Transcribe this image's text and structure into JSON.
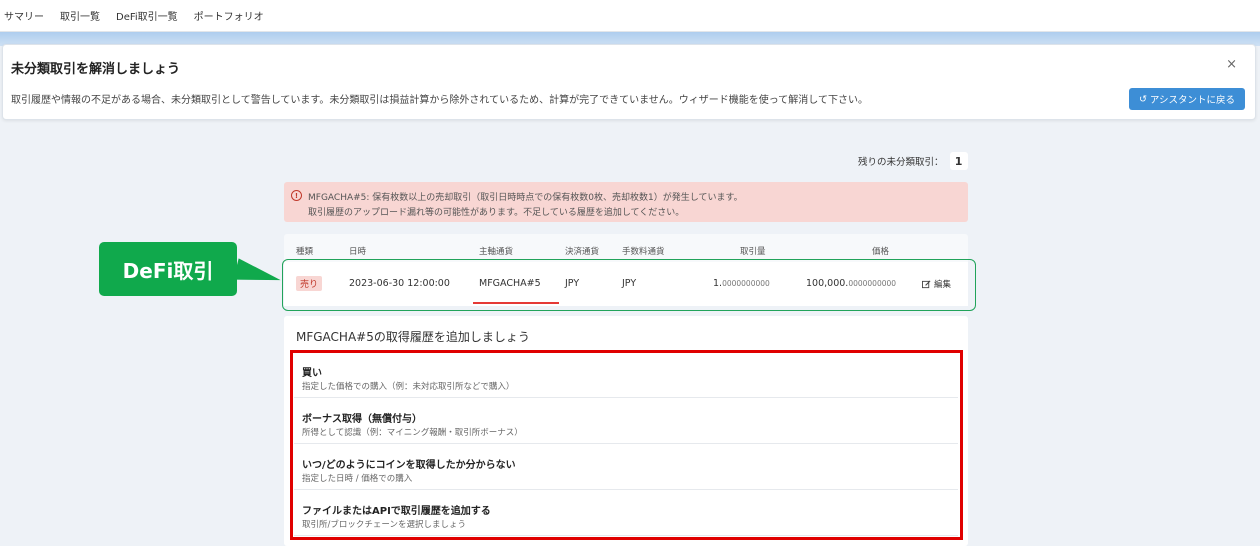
{
  "nav": {
    "items": [
      "サマリー",
      "取引一覧",
      "DeFi取引一覧",
      "ポートフォリオ"
    ]
  },
  "banner": {
    "title": "未分類取引を解消しましょう",
    "description": "取引履歴や情報の不足がある場合、未分類取引として警告しています。未分類取引は損益計算から除外されているため、計算が完了できていません。ウィザード機能を使って解消して下さい。",
    "close": "×",
    "assistant_button": "アシスタントに戻る",
    "assistant_icon": "↺"
  },
  "remaining": {
    "label": "残りの未分類取引：",
    "count": "1"
  },
  "alert": {
    "icon": "!",
    "line1": "MFGACHA#5: 保有枚数以上の売却取引（取引日時時点での保有枚数0枚、売却枚数1）が発生しています。",
    "line2": "取引履歴のアップロード漏れ等の可能性があります。不足している履歴を追加してください。"
  },
  "table": {
    "headers": [
      "種類",
      "日時",
      "主軸通貨",
      "決済通貨",
      "手数料通貨",
      "取引量",
      "価格"
    ],
    "row": {
      "type": "売り",
      "datetime": "2023-06-30 12:00:00",
      "base": "MFGACHA#5",
      "settlement": "JPY",
      "fee": "JPY",
      "amount_int": "1.",
      "amount_dec": "0000000000",
      "price_int": "100,000.",
      "price_dec": "0000000000",
      "edit": "編集"
    }
  },
  "annotation": {
    "label": "DeFi取引"
  },
  "options": {
    "title": "MFGACHA#5の取得履歴を追加しましょう",
    "items": [
      {
        "title": "買い",
        "desc": "指定した価格での購入（例：未対応取引所などで購入）"
      },
      {
        "title": "ボーナス取得（無償付与）",
        "desc": "所得として認識（例：マイニング報酬・取引所ボーナス）"
      },
      {
        "title": "いつ/どのようにコインを取得したか分からない",
        "desc": "指定した日時 / 価格での購入"
      },
      {
        "title": "ファイルまたはAPIで取引履歴を追加する",
        "desc": "取引所/ブロックチェーンを選択しましょう"
      }
    ]
  },
  "colors": {
    "accent": "#3d8ed6",
    "annotation_green": "#10a94c",
    "highlight_red": "#e00000",
    "alert_bg": "#f8d6d3"
  }
}
